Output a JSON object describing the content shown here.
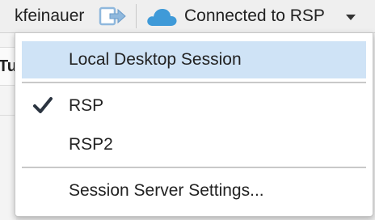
{
  "toolbar": {
    "username": "kfeinauer",
    "signout_icon": "signout-arrow-icon",
    "connection_icon": "cloud-icon",
    "connection_label": "Connected to RSP",
    "dropdown_icon": "caret-down-icon"
  },
  "background": {
    "tab_fragment": "Tu"
  },
  "menu": {
    "items": [
      {
        "label": "Local Desktop Session",
        "highlighted": true,
        "checked": false
      },
      {
        "label": "RSP",
        "highlighted": false,
        "checked": true
      },
      {
        "label": "RSP2",
        "highlighted": false,
        "checked": false
      },
      {
        "label": "Session Server Settings...",
        "highlighted": false,
        "checked": false
      }
    ],
    "check_icon": "checkmark-icon"
  },
  "colors": {
    "highlight": "#cfe3f6",
    "cloud": "#3f9ad8",
    "signout_icon": "#8fb8dd",
    "text": "#222222"
  }
}
